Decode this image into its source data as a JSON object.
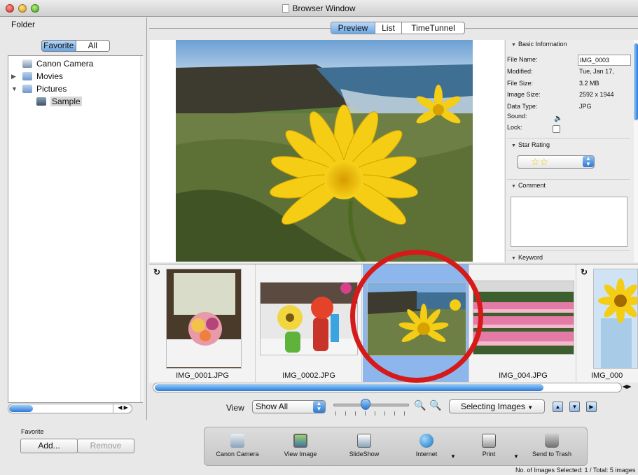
{
  "window": {
    "title": "Browser Window"
  },
  "sidebar": {
    "folder_label": "Folder",
    "segment": [
      {
        "label": "Favorite",
        "selected": true
      },
      {
        "label": "All",
        "selected": false
      }
    ],
    "tree": [
      {
        "label": "Canon Camera",
        "icon": "camera-icon"
      },
      {
        "label": "Movies",
        "icon": "folder-icon"
      },
      {
        "label": "Pictures",
        "icon": "folder-icon"
      },
      {
        "label": "Sample",
        "icon": "folder-icon",
        "selected": true
      }
    ],
    "favorite_title": "Favorite",
    "add_label": "Add...",
    "remove_label": "Remove"
  },
  "tabs": [
    {
      "label": "Preview",
      "selected": true
    },
    {
      "label": "List",
      "selected": false
    },
    {
      "label": "TimeTunnel",
      "selected": false
    }
  ],
  "info": {
    "basic_title": "Basic Information",
    "rows": [
      {
        "key": "File Name:",
        "value": "IMG_0003"
      },
      {
        "key": "Modified:",
        "value": "Tue, Jan 17,"
      },
      {
        "key": "File Size:",
        "value": "3.2 MB"
      },
      {
        "key": "Image Size:",
        "value": "2592 x 1944"
      },
      {
        "key": "Data Type:",
        "value": "JPG"
      },
      {
        "key": "Sound:",
        "value": ""
      },
      {
        "key": "Lock:",
        "value": ""
      }
    ],
    "star_title": "Star Rating",
    "star_value": "☆☆",
    "comment_title": "Comment",
    "keyword_title": "Keyword"
  },
  "thumbnails": [
    {
      "caption": "IMG_0001.JPG",
      "selected": false
    },
    {
      "caption": "IMG_0002.JPG",
      "selected": false
    },
    {
      "caption": "",
      "selected": true
    },
    {
      "caption": "IMG_004.JPG",
      "selected": false
    },
    {
      "caption": "IMG_000",
      "selected": false
    }
  ],
  "controls": {
    "view_label": "View",
    "view_value": "Show All",
    "selecting_label": "Selecting Images"
  },
  "tasks": [
    {
      "label": "Canon Camera"
    },
    {
      "label": "View Image"
    },
    {
      "label": "SlideShow"
    },
    {
      "label": "Internet"
    },
    {
      "label": "Print"
    },
    {
      "label": "Send to Trash"
    }
  ],
  "status": "No. of Images Selected: 1 / Total: 5 images",
  "colors": {
    "accent": "#3b84d8",
    "highlight_ring": "#d61a1a"
  }
}
